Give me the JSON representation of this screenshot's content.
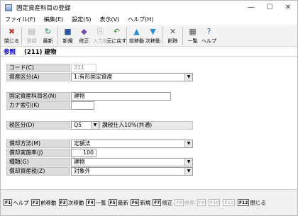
{
  "window": {
    "title": "固定資産科目の登録",
    "minimize": "—",
    "maximize": "☐",
    "close": "✕"
  },
  "menu": [
    "ファイル(F)",
    "編集(E)",
    "設定(S)",
    "表示(V)",
    "ヘルプ(H)"
  ],
  "toolbar": [
    {
      "label": "閉じる",
      "icon": "close-doc-icon",
      "glyph": "✖",
      "color": "#c0392b",
      "disabled": false
    },
    {
      "label": "登録",
      "icon": "register-icon",
      "glyph": "▤",
      "color": "#9a9a9a",
      "disabled": true
    },
    {
      "label": "最新",
      "icon": "refresh-icon",
      "glyph": "↻",
      "color": "#2e8b57",
      "disabled": false
    },
    {
      "label": "新規",
      "icon": "new-icon",
      "glyph": "■",
      "color": "#2c5aa0",
      "disabled": false
    },
    {
      "label": "修正",
      "icon": "edit-icon",
      "glyph": "◆",
      "color": "#7d4cb0",
      "disabled": false
    },
    {
      "label": "入力前",
      "icon": "undo-input-icon",
      "glyph": "⎘",
      "color": "#9a9a9a",
      "disabled": true
    },
    {
      "label": "元に戻す",
      "icon": "revert-icon",
      "glyph": "↶",
      "color": "#2e7d32",
      "disabled": false
    },
    {
      "label": "前移動",
      "icon": "up-arrow-icon",
      "glyph": "▲",
      "color": "#2f8fd0",
      "disabled": false
    },
    {
      "label": "次移動",
      "icon": "down-arrow-icon",
      "glyph": "▼",
      "color": "#2f8fd0",
      "disabled": false
    },
    {
      "label": "削除",
      "icon": "delete-icon",
      "glyph": "✕",
      "color": "#555555",
      "disabled": false
    },
    {
      "label": "一覧",
      "icon": "list-icon",
      "glyph": "▦",
      "color": "#555555",
      "disabled": false
    },
    {
      "label": "ヘルプ",
      "icon": "help-icon",
      "glyph": "?",
      "color": "#2c5aa0",
      "disabled": false
    }
  ],
  "header": {
    "mode": "参照",
    "record": "(211) 建物"
  },
  "form": {
    "code_label": "コード(C)",
    "code_value": "211",
    "asset_class_label": "資産区分(A)",
    "asset_class_value": "1:有形固定資産",
    "name_label": "固定資産科目名(N)",
    "name_value": "建物",
    "kana_label": "カナ索引(K)",
    "kana_value": "",
    "tax_class_label": "税区分(D)",
    "tax_class_code": "Q5",
    "tax_class_desc": "課税仕入10%(共通)",
    "dep_method_label": "償却方法(M)",
    "dep_method_value": "定額法",
    "dep_rate_label": "償却実施率(J)",
    "dep_rate_value": "100",
    "kind_label": "種類(G)",
    "kind_value": "建物",
    "dep_asset_tax_label": "償却資産税(Z)",
    "dep_asset_tax_value": "対象外"
  },
  "fkeys": [
    {
      "key": "F1",
      "label": "ヘルプ",
      "disabled": false
    },
    {
      "key": "F2",
      "label": "前移動",
      "disabled": false
    },
    {
      "key": "F3",
      "label": "次移動",
      "disabled": false
    },
    {
      "key": "F4",
      "label": "一覧",
      "disabled": false
    },
    {
      "key": "F5",
      "label": "最新",
      "disabled": false
    },
    {
      "key": "F6",
      "label": "新規",
      "disabled": false
    },
    {
      "key": "F7",
      "label": "修正",
      "disabled": false
    },
    {
      "key": "F8",
      "label": "参照",
      "disabled": true
    },
    {
      "key": "F9",
      "label": "",
      "disabled": true
    },
    {
      "key": "F10",
      "label": "",
      "disabled": true
    },
    {
      "key": "F11",
      "label": "",
      "disabled": true
    },
    {
      "key": "F12",
      "label": "閉じる",
      "disabled": false
    }
  ]
}
